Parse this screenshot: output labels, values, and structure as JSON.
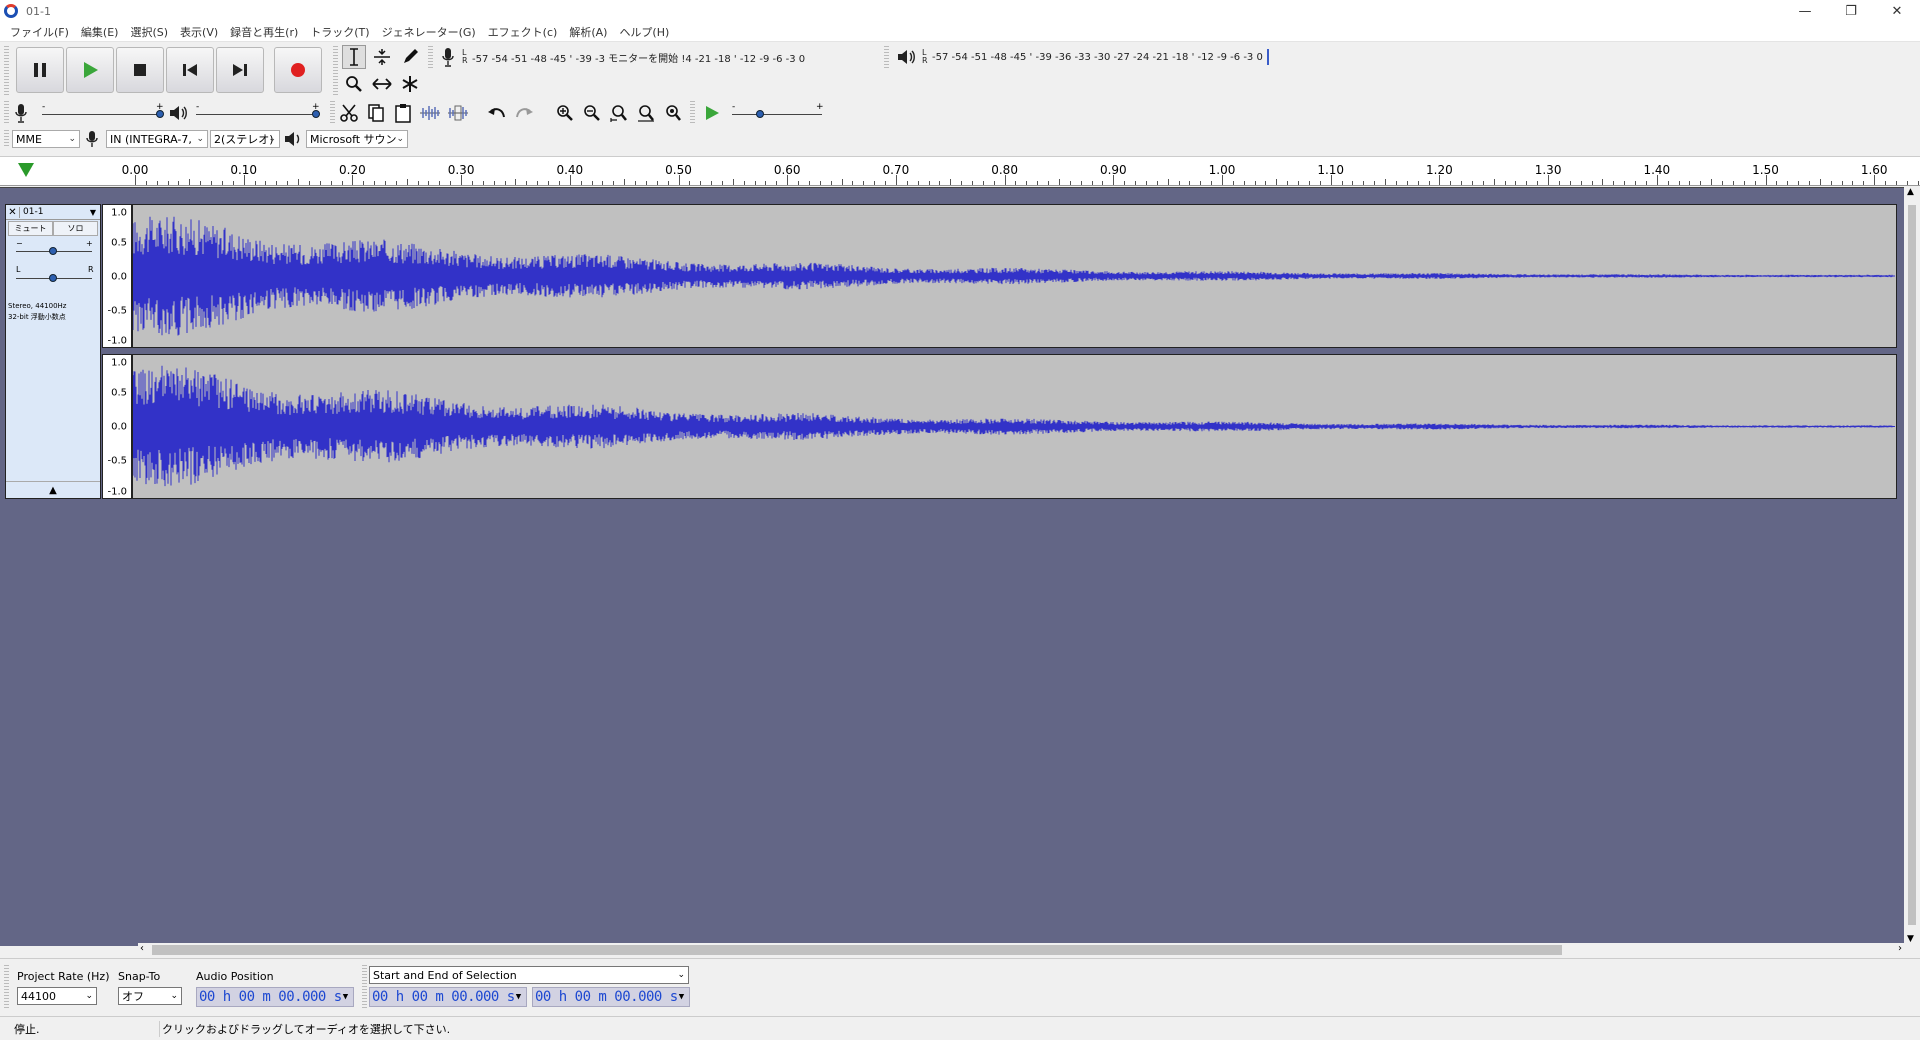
{
  "window": {
    "title": "01-1",
    "minimize": "—",
    "restore": "❐",
    "close": "✕"
  },
  "menu": [
    "ファイル(F)",
    "編集(E)",
    "選択(S)",
    "表示(V)",
    "録音と再生(r)",
    "トラック(T)",
    "ジェネレーター(G)",
    "エフェクト(c)",
    "解析(A)",
    "ヘルプ(H)"
  ],
  "transport": {
    "pause_icon": "pause-icon",
    "play_icon": "play-icon",
    "stop_icon": "stop-icon",
    "skip_start_icon": "skip-start-icon",
    "skip_end_icon": "skip-end-icon",
    "record_icon": "record-icon",
    "play_color": "#3aa63a",
    "record_color": "#e02020"
  },
  "meters": {
    "record_scale": "-57 -54 -51 -48 -45 ' -39 -3 モニターを開始 !4 -21 -18 ' -12 -9 -6 -3 0",
    "playback_scale": "-57 -54 -51 -48 -45 ' -39 -36 -33 -30 -27 -24 -21 -18 ' -12 -9 -6 -3 0",
    "l": "L",
    "r": "R"
  },
  "mixer": {
    "minus": "-",
    "plus": "+"
  },
  "devices": {
    "host": "MME",
    "input": "IN (INTEGRA-7,",
    "channels": "2(ステレオ)",
    "output": "Microsoft サウン"
  },
  "ruler": {
    "labels": [
      "0.00",
      "0.10",
      "0.20",
      "0.30",
      "0.40",
      "0.50",
      "0.60",
      "0.70",
      "0.80",
      "0.90",
      "1.00",
      "1.10",
      "1.20",
      "1.30",
      "1.40",
      "1.50",
      "1.60"
    ]
  },
  "track": {
    "name": "01-1",
    "close": "✕",
    "mute": "ミュート",
    "solo": "ソロ",
    "gain_minus": "−",
    "gain_plus": "+",
    "pan_l": "L",
    "pan_r": "R",
    "info1": "Stereo, 44100Hz",
    "info2": "32-bit 浮動小数点",
    "collapse": "▲",
    "scale": [
      "1.0",
      "0.5",
      "0.0",
      "-0.5",
      "-1.0"
    ]
  },
  "selection_bar": {
    "rate_label": "Project Rate (Hz)",
    "rate_value": "44100",
    "snap_label": "Snap-To",
    "snap_value": "オフ",
    "audio_pos_label": "Audio Position",
    "audio_pos_value": "00 h 00 m 00.000 s",
    "sel_label": "Start and End of Selection",
    "sel_start": "00 h 00 m 00.000 s",
    "sel_end": "00 h 00 m 00.000 s"
  },
  "status": {
    "state": "停止.",
    "hint": "クリックおよびドラッグしてオーディオを選択して下さい."
  },
  "colors": {
    "wave": "#3232c8",
    "track_bg": "#636686",
    "wave_bg": "#c0c0c0",
    "time_text": "#1d48d1"
  }
}
